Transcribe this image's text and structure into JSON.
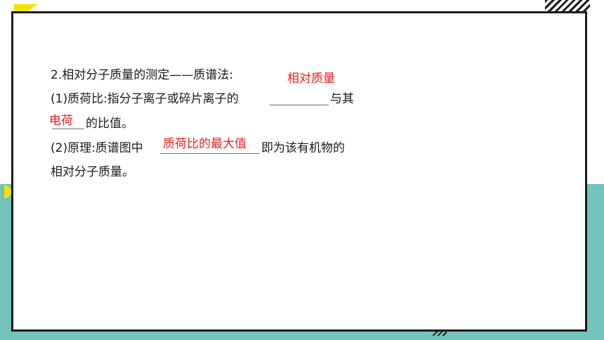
{
  "lines": {
    "heading": "2.相对分子质量的测定——质谱法:",
    "line1_a": "(1)质荷比:指分子离子或碎片离子的",
    "line1_b": "与其",
    "line2": "的比值。",
    "line3_a": "(2)原理:质谱图中",
    "line3_b": "即为该有机物的",
    "line4": "相对分子质量。"
  },
  "answers": {
    "blank1": "相对质量",
    "blank2": "电荷",
    "blank3": "质荷比的最大值"
  },
  "colors": {
    "answer": "#e8211d",
    "accent_band": "#72c4bb",
    "highlight": "#f4e200"
  }
}
